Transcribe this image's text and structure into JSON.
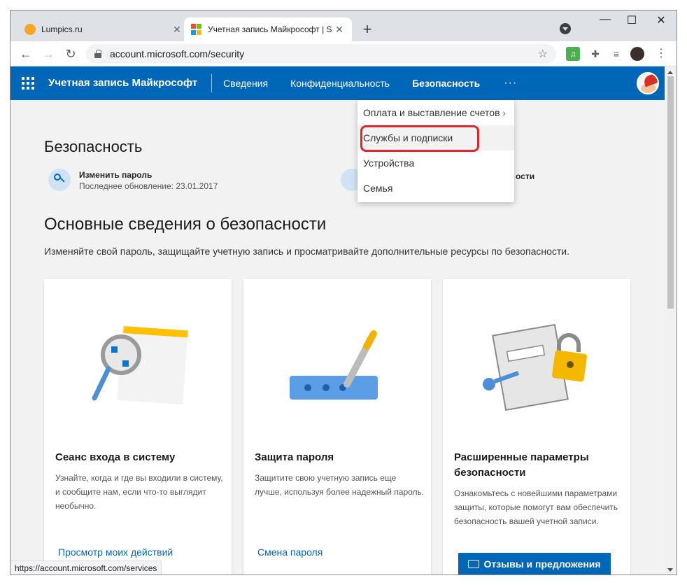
{
  "browser": {
    "tabs": [
      {
        "title": "Lumpics.ru",
        "close": "✕"
      },
      {
        "title": "Учетная запись Майкрософт | S",
        "close": "✕"
      }
    ],
    "new_tab": "+",
    "window_controls": {
      "minimize": "—",
      "maximize": "☐",
      "close": "✕"
    },
    "url": "account.microsoft.com/security",
    "status_url": "https://account.microsoft.com/services"
  },
  "header": {
    "brand": "Учетная запись Майкрософт",
    "nav": [
      "Сведения",
      "Конфиденциальность",
      "Безопасность"
    ],
    "more": "···",
    "accent_color": "#0067b8"
  },
  "dropdown": {
    "items": [
      "Оплата и выставление счетов",
      "Службы и подписки",
      "Устройства",
      "Семья"
    ],
    "highlighted": "Службы и подписки",
    "highlight_color": "#e0262d"
  },
  "security": {
    "title": "Безопасность",
    "password_change": "Изменить пароль",
    "password_updated": "Последнее обновление: 23.01.2017",
    "partial_text": "ости"
  },
  "basics": {
    "title": "Основные сведения о безопасности",
    "description": "Изменяйте свой пароль, защищайте учетную запись и просматривайте дополнительные ресурсы по безопасности."
  },
  "cards": [
    {
      "title": "Сеанс входа в систему",
      "description": "Узнайте, когда и где вы входили в систему, и сообщите нам, если что-то выглядит необычно.",
      "link": "Просмотр моих действий"
    },
    {
      "title": "Защита пароля",
      "description": "Защитите свою учетную запись еще лучше, используя более надежный пароль.",
      "link": "Смена пароля"
    },
    {
      "title": "Расширенные параметры безопасности",
      "description": "Ознакомьтесь с новейшими параметрами защиты, которые помогут вам обеспечить безопасность вашей учетной записи.",
      "link": ""
    }
  ],
  "feedback_button": "Отзывы и предложения"
}
